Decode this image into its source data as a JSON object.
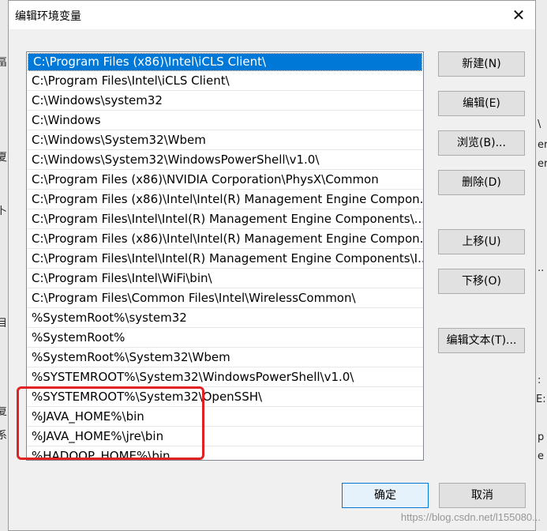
{
  "dialog": {
    "title": "编辑环境变量",
    "close_glyph": "✕"
  },
  "path_entries": [
    "C:\\Program Files (x86)\\Intel\\iCLS Client\\",
    "C:\\Program Files\\Intel\\iCLS Client\\",
    "C:\\Windows\\system32",
    "C:\\Windows",
    "C:\\Windows\\System32\\Wbem",
    "C:\\Windows\\System32\\WindowsPowerShell\\v1.0\\",
    "C:\\Program Files (x86)\\NVIDIA Corporation\\PhysX\\Common",
    "C:\\Program Files (x86)\\Intel\\Intel(R) Management Engine Compon...",
    "C:\\Program Files\\Intel\\Intel(R) Management Engine Components\\...",
    "C:\\Program Files (x86)\\Intel\\Intel(R) Management Engine Compon...",
    "C:\\Program Files\\Intel\\Intel(R) Management Engine Components\\I...",
    "C:\\Program Files\\Intel\\WiFi\\bin\\",
    "C:\\Program Files\\Common Files\\Intel\\WirelessCommon\\",
    "%SystemRoot%\\system32",
    "%SystemRoot%",
    "%SystemRoot%\\System32\\Wbem",
    "%SYSTEMROOT%\\System32\\WindowsPowerShell\\v1.0\\",
    "%SYSTEMROOT%\\System32\\OpenSSH\\",
    "%JAVA_HOME%\\bin",
    "%JAVA_HOME%\\jre\\bin",
    "%HADOOP_HOME%\\bin"
  ],
  "buttons": {
    "new": "新建(N)",
    "edit": "编辑(E)",
    "browse": "浏览(B)...",
    "delete": "删除(D)",
    "move_up": "上移(U)",
    "move_down": "下移(O)",
    "edit_text": "编辑文本(T)...",
    "ok": "确定",
    "cancel": "取消"
  },
  "background_fragments": {
    "left": [
      "畐",
      "夏",
      "卜",
      "目",
      "复",
      "系"
    ],
    "right": [
      "\\",
      "er",
      "er",
      "..",
      ":",
      "E:",
      "p",
      "e"
    ]
  },
  "watermark": "https://blog.csdn.net/l155080..."
}
